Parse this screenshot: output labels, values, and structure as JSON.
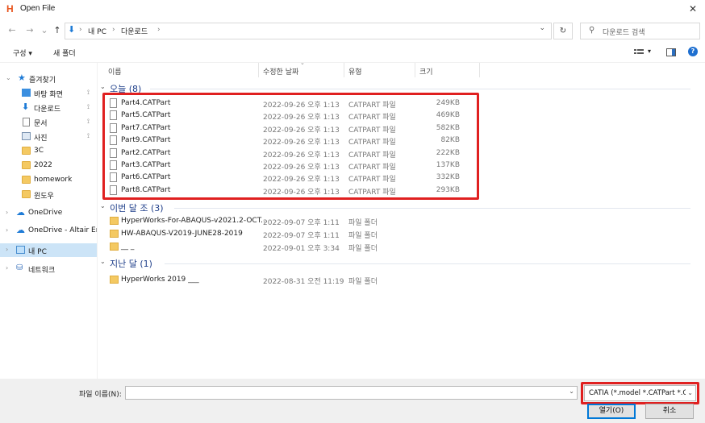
{
  "window": {
    "title": "Open File",
    "close": "✕"
  },
  "nav": {
    "back": "←",
    "forward": "→",
    "recent": "⌄",
    "up": "↑",
    "breadcrumb": [
      "내 PC",
      "다운로드"
    ],
    "separator": "›",
    "dropdown": "⌄",
    "refresh": "↻",
    "search_placeholder": "다운로드 검색"
  },
  "toolbar": {
    "organize": "구성 ▾",
    "new_folder": "새 폴더",
    "view_menu": "▾",
    "help": "?"
  },
  "sidebar": {
    "items": [
      {
        "label": "즐겨찾기",
        "icon": "star-icon",
        "caret": "⌄"
      },
      {
        "label": "바탕 화면",
        "icon": "desktop-icon",
        "pin": "📌"
      },
      {
        "label": "다운로드",
        "icon": "download-icon",
        "pin": "📌"
      },
      {
        "label": "문서",
        "icon": "document-icon",
        "pin": "📌"
      },
      {
        "label": "사진",
        "icon": "picture-icon",
        "pin": "📌"
      },
      {
        "label": "3C",
        "icon": "folder-icon"
      },
      {
        "label": "2022",
        "icon": "folder-icon"
      },
      {
        "label": "homework",
        "icon": "folder-icon"
      },
      {
        "label": "윈도우",
        "icon": "folder-icon"
      },
      {
        "label": "OneDrive",
        "icon": "cloud-icon",
        "caret": "›"
      },
      {
        "label": "OneDrive - Altair Eng",
        "icon": "cloud-icon",
        "caret": "›"
      },
      {
        "label": "내 PC",
        "icon": "pc-icon",
        "caret": "›"
      },
      {
        "label": "네트워크",
        "icon": "network-icon",
        "caret": "›"
      }
    ]
  },
  "columns": {
    "name": "이름",
    "date": "수정한 날짜",
    "type": "유형",
    "size": "크기"
  },
  "groups": [
    {
      "label": "오늘 (8)",
      "caret": "⌄",
      "files": [
        {
          "name": "Part4.CATPart",
          "date": "2022-09-26 오후 1:13",
          "type": "CATPART 파일",
          "size": "249KB"
        },
        {
          "name": "Part5.CATPart",
          "date": "2022-09-26 오후 1:13",
          "type": "CATPART 파일",
          "size": "469KB"
        },
        {
          "name": "Part7.CATPart",
          "date": "2022-09-26 오후 1:13",
          "type": "CATPART 파일",
          "size": "582KB"
        },
        {
          "name": "Part9.CATPart",
          "date": "2022-09-26 오후 1:13",
          "type": "CATPART 파일",
          "size": "82KB"
        },
        {
          "name": "Part2.CATPart",
          "date": "2022-09-26 오후 1:13",
          "type": "CATPART 파일",
          "size": "222KB"
        },
        {
          "name": "Part3.CATPart",
          "date": "2022-09-26 오후 1:13",
          "type": "CATPART 파일",
          "size": "137KB"
        },
        {
          "name": "Part6.CATPart",
          "date": "2022-09-26 오후 1:13",
          "type": "CATPART 파일",
          "size": "332KB"
        },
        {
          "name": "Part8.CATPart",
          "date": "2022-09-26 오후 1:13",
          "type": "CATPART 파일",
          "size": "293KB"
        }
      ]
    },
    {
      "label": "이번 달 조 (3)",
      "caret": "⌄",
      "files": [
        {
          "name": "HyperWorks-For-ABAQUS-v2021.2-OCT...",
          "date": "2022-09-07 오후 1:11",
          "type": "파일 폴더",
          "size": ""
        },
        {
          "name": "HW-ABAQUS-V2019-JUNE28-2019",
          "date": "2022-09-07 오후 1:11",
          "type": "파일 폴더",
          "size": ""
        },
        {
          "name": "__ _",
          "date": "2022-09-01 오후 3:34",
          "type": "파일 폴더",
          "size": ""
        }
      ]
    },
    {
      "label": "지난 달 (1)",
      "caret": "⌄",
      "files": [
        {
          "name": "HyperWorks 2019 ___",
          "date": "2022-08-31 오전 11:19",
          "type": "파일 폴더",
          "size": ""
        }
      ]
    }
  ],
  "bottom": {
    "filename_label": "파일 이름(N):",
    "filename_value": "",
    "filter": "CATIA (*.model *.CATPart *.CA",
    "open": "열기(O)",
    "cancel": "취소"
  },
  "colors": {
    "highlight": "#e02020",
    "accent": "#0078d7",
    "selected_nav": "#cce4f7"
  }
}
